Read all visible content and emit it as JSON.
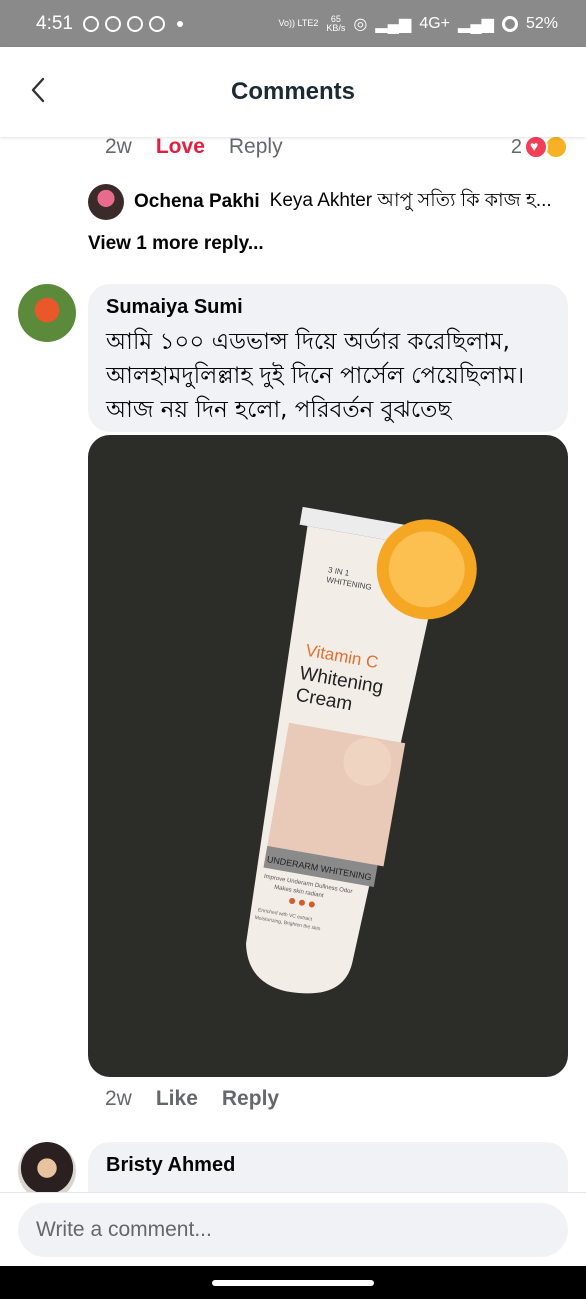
{
  "status_bar": {
    "time": "4:51",
    "network_label": "Vo)) LTE2",
    "speed_value": "65",
    "speed_unit": "KB/s",
    "signal_label": "4G+",
    "battery": "52%"
  },
  "header": {
    "title": "Comments"
  },
  "prev_comment": {
    "time": "2w",
    "reaction_label": "Love",
    "reply_label": "Reply",
    "reaction_count": "2",
    "reaction_icons": [
      "heart-icon",
      "haha-icon"
    ],
    "reply_preview": {
      "name": "Ochena Pakhi",
      "text": "Keya Akhter আপু সত্যি  কি কাজ হ..."
    },
    "view_more": "View 1 more reply..."
  },
  "comment_1": {
    "author": "Sumaiya Sumi",
    "text": "আমি ১০০ এডভান্স দিয়ে অর্ডার করেছিলাম, আলহামদুলিল্লাহ দুই দিনে পার্সেল পেয়েছিলাম। আজ নয় দিন হলো, পরিবর্তন বুঝতেছ",
    "photo": {
      "top_label_1": "3 IN 1",
      "top_label_2": "WHITENING",
      "line1": "Vitamin C",
      "line2": "Whitening",
      "line3": "Cream",
      "band": "UNDERARM WHITENING",
      "desc1": "Improve Underarm Dullness Odor",
      "desc2": "Makes skin radiant",
      "small1": "Enriched with VC extract",
      "small2": "Moisturizing, Brighten the skin"
    },
    "time": "2w",
    "like_label": "Like",
    "reply_label": "Reply"
  },
  "comment_2": {
    "author": "Bristy Ahmed"
  },
  "composer": {
    "placeholder": "Write a comment..."
  },
  "colors": {
    "love": "#e41e3f",
    "bubble": "#f0f2f5",
    "photo_bg": "#2c2c29"
  }
}
